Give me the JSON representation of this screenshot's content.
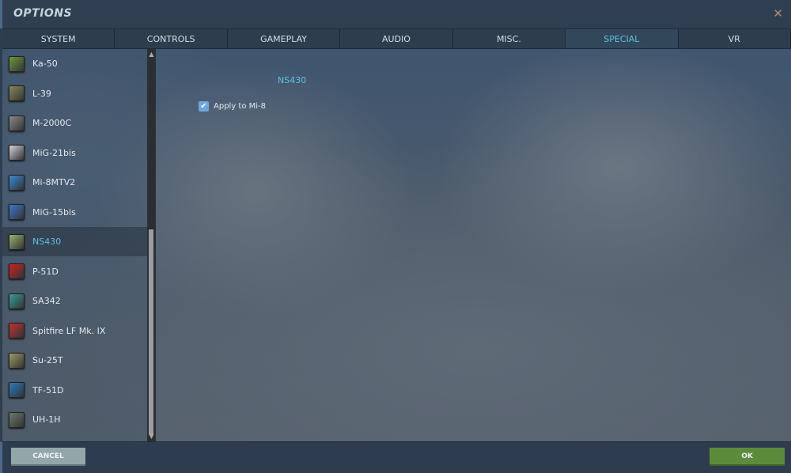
{
  "window": {
    "title": "OPTIONS",
    "close_icon": "close-icon"
  },
  "tabs": [
    {
      "label": "SYSTEM"
    },
    {
      "label": "CONTROLS"
    },
    {
      "label": "GAMEPLAY"
    },
    {
      "label": "AUDIO"
    },
    {
      "label": "MISC."
    },
    {
      "label": "SPECIAL",
      "active": true
    },
    {
      "label": "VR"
    }
  ],
  "sidebar": {
    "items": [
      {
        "label": "Ka-50",
        "color": "#6a9a3a"
      },
      {
        "label": "L-39",
        "color": "#8a8a5a"
      },
      {
        "label": "M-2000C",
        "color": "#8a8a8a"
      },
      {
        "label": "MiG-21bis",
        "color": "#d0d0d8"
      },
      {
        "label": "Mi-8MTV2",
        "color": "#3a8ad0"
      },
      {
        "label": "MiG-15bis",
        "color": "#3a7ad0"
      },
      {
        "label": "NS430",
        "color": "#9ab070",
        "selected": true
      },
      {
        "label": "P-51D",
        "color": "#d02020"
      },
      {
        "label": "SA342",
        "color": "#3a9a9a"
      },
      {
        "label": "Spitfire LF Mk. IX",
        "color": "#c03030"
      },
      {
        "label": "Su-25T",
        "color": "#9a9a6a"
      },
      {
        "label": "TF-51D",
        "color": "#2a7ac0"
      },
      {
        "label": "UH-1H",
        "color": "#6a7a6a"
      }
    ]
  },
  "panel": {
    "heading": "NS430",
    "checkbox": {
      "label": "Apply to Mi-8",
      "checked": true
    }
  },
  "footer": {
    "cancel": "CANCEL",
    "ok": "OK"
  }
}
